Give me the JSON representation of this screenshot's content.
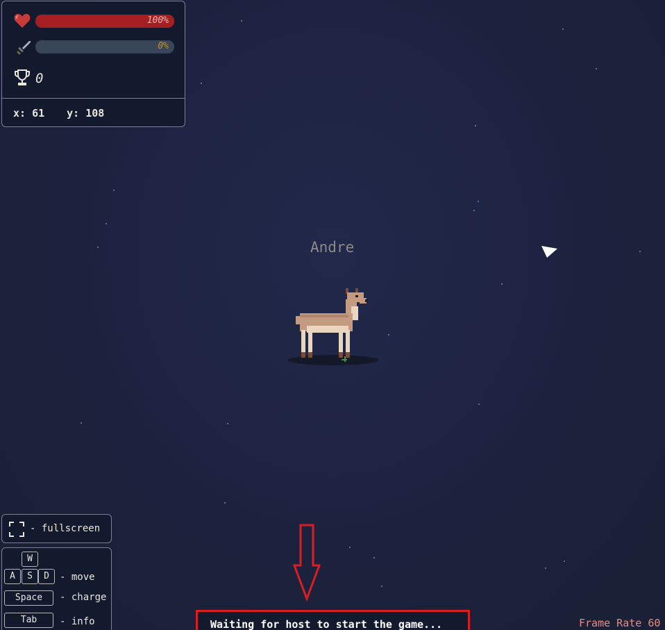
{
  "hud": {
    "health": {
      "percent": 1.0,
      "label": "100%",
      "icon": "heart-icon"
    },
    "charge": {
      "percent": 0.0,
      "label": "0%",
      "icon": "sword-icon"
    },
    "score": {
      "value": "0",
      "icon": "trophy-icon"
    },
    "coords": {
      "x_label": "x: 61",
      "y_label": "y: 108"
    }
  },
  "player": {
    "name": "Andre",
    "sprite": "deer"
  },
  "controls": {
    "fullscreen": {
      "icon": "fullscreen-icon",
      "label": "- fullscreen"
    },
    "keys": {
      "w": "W",
      "a": "A",
      "s": "S",
      "d": "D",
      "move_label": "- move",
      "space": "Space",
      "charge_label": "- charge",
      "tab": "Tab",
      "info_label": "- info"
    }
  },
  "status": {
    "waiting": "Waiting for host to start the game..."
  },
  "framerate": {
    "label": "Frame Rate 60"
  },
  "colors": {
    "health_fill": "#a51f22",
    "charge_text": "#c98f1a",
    "annotation_red": "#d81e23",
    "framerate_text": "#e58d8a",
    "star": "#6fa6d6"
  }
}
